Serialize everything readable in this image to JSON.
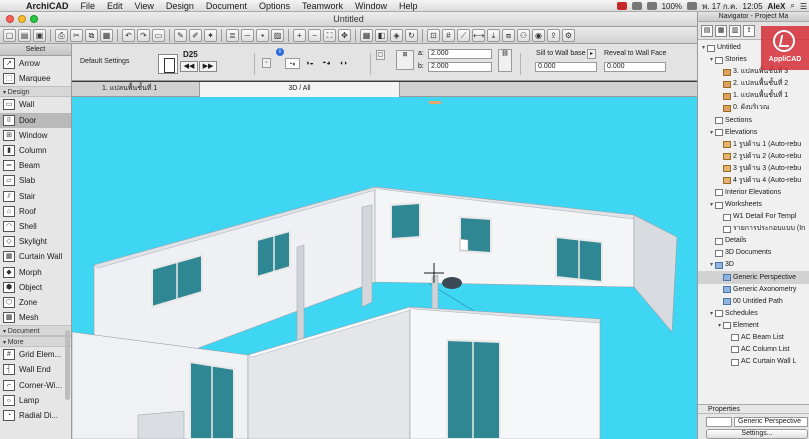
{
  "menubar": {
    "apple_symbol": "",
    "items": [
      "ArchiCAD",
      "File",
      "Edit",
      "View",
      "Design",
      "Document",
      "Options",
      "Teamwork",
      "Window",
      "Help"
    ],
    "battery": "100%",
    "date": "พ. 17 ก.ค.",
    "time": "12:05",
    "user": "AleX"
  },
  "window": {
    "title": "Untitled"
  },
  "infobox": {
    "default_settings": "Default Settings",
    "layer": "D25",
    "prev": "◀◀",
    "next": "▶▶",
    "width_label": "a:",
    "width_value": "2.000",
    "height_label": "b:",
    "height_value": "2.000",
    "sill_label": "Sill to Wall base",
    "sill_value": "0.000",
    "reveal_label": "Reveal to Wall Face",
    "reveal_value": "0.000"
  },
  "toolbox": {
    "select_header": "Select",
    "arrow": "Arrow",
    "marquee": "Marquee",
    "design_group": "Design",
    "design_items": [
      "Wall",
      "Door",
      "Window",
      "Column",
      "Beam",
      "Slab",
      "Stair",
      "Roof",
      "Shell",
      "Skylight",
      "Curtain Wall",
      "Morph",
      "Object",
      "Zone",
      "Mesh"
    ],
    "document_group": "Document",
    "more_group": "More",
    "more_items": [
      "Grid Elem...",
      "Wall End",
      "Corner-Wi...",
      "Lamp",
      "Radial Di..."
    ],
    "active_item": "Door"
  },
  "tabs": [
    {
      "label": "1. แปลนพื้นชั้นที่ 1"
    },
    {
      "label": "3D / All"
    }
  ],
  "navigator": {
    "title": "Navigator - Project Ma",
    "watermark": "AppliCAD",
    "tree": [
      {
        "label": "Untitled",
        "depth": 0,
        "open": true,
        "icon": "doc"
      },
      {
        "label": "Stories",
        "depth": 1,
        "open": true,
        "icon": "doc"
      },
      {
        "label": "3. แปลนพื้นชั้นที่ 3",
        "depth": 2,
        "icon": "folder"
      },
      {
        "label": "2. แปลนพื้นชั้นที่ 2",
        "depth": 2,
        "icon": "folder"
      },
      {
        "label": "1. แปลนพื้นชั้นที่ 1",
        "depth": 2,
        "icon": "folder"
      },
      {
        "label": "0. ผังบริเวณ",
        "depth": 2,
        "icon": "folder"
      },
      {
        "label": "Sections",
        "depth": 1,
        "icon": "doc"
      },
      {
        "label": "Elevations",
        "depth": 1,
        "open": true,
        "icon": "doc"
      },
      {
        "label": "1 รูปด้าน 1 (Auto-rebu",
        "depth": 2,
        "icon": "elev"
      },
      {
        "label": "2 รูปด้าน 2 (Auto-rebu",
        "depth": 2,
        "icon": "elev"
      },
      {
        "label": "3 รูปด้าน 3 (Auto-rebu",
        "depth": 2,
        "icon": "elev"
      },
      {
        "label": "4 รูปด้าน 4 (Auto-rebu",
        "depth": 2,
        "icon": "elev"
      },
      {
        "label": "Interior Elevations",
        "depth": 1,
        "icon": "doc"
      },
      {
        "label": "Worksheets",
        "depth": 1,
        "open": true,
        "icon": "doc"
      },
      {
        "label": "W1 Detail For Templ",
        "depth": 2,
        "icon": "doc"
      },
      {
        "label": "รายการประกอบแบบ (In",
        "depth": 2,
        "icon": "doc"
      },
      {
        "label": "Details",
        "depth": 1,
        "icon": "doc"
      },
      {
        "label": "3D Documents",
        "depth": 1,
        "icon": "doc"
      },
      {
        "label": "3D",
        "depth": 1,
        "open": true,
        "icon": "cube"
      },
      {
        "label": "Generic Perspective",
        "depth": 2,
        "icon": "cube",
        "selected": true
      },
      {
        "label": "Generic Axonometry",
        "depth": 2,
        "icon": "cube"
      },
      {
        "label": "00 Untitled Path",
        "depth": 2,
        "icon": "cube"
      },
      {
        "label": "Schedules",
        "depth": 1,
        "open": true,
        "icon": "doc"
      },
      {
        "label": "Element",
        "depth": 2,
        "open": true,
        "icon": "doc"
      },
      {
        "label": "AC Beam List",
        "depth": 3,
        "icon": "doc"
      },
      {
        "label": "AC Column List",
        "depth": 3,
        "icon": "doc"
      },
      {
        "label": "AC Curtain Wall L",
        "depth": 3,
        "icon": "doc"
      }
    ],
    "properties_header": "Properties",
    "properties_value": "Generic Perspective",
    "settings_button": "Settings..."
  },
  "colors": {
    "viewport_bg": "#3fd6f3",
    "wall_light": "#f3f3f5",
    "wall_shade": "#c6c8cc",
    "glass": "#2f8794",
    "accent_red": "#d62d37"
  }
}
